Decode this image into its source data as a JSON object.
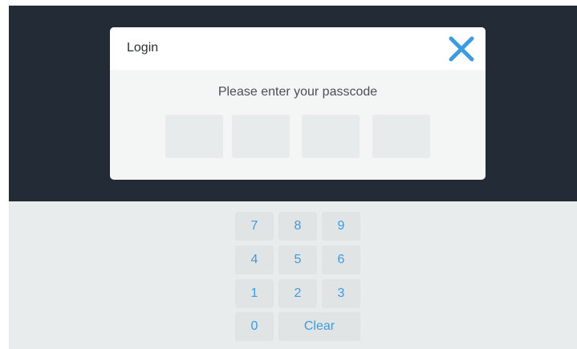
{
  "modal": {
    "title": "Login",
    "prompt": "Please enter your passcode",
    "close_icon": "close-icon",
    "accent_color": "#3d9be0"
  },
  "passcode": {
    "digits": [
      "",
      "",
      "",
      ""
    ]
  },
  "keypad": {
    "keys": [
      {
        "label": "7"
      },
      {
        "label": "8"
      },
      {
        "label": "9"
      },
      {
        "label": "4"
      },
      {
        "label": "5"
      },
      {
        "label": "6"
      },
      {
        "label": "1"
      },
      {
        "label": "2"
      },
      {
        "label": "3"
      },
      {
        "label": "0"
      },
      {
        "label": "Clear"
      }
    ]
  }
}
